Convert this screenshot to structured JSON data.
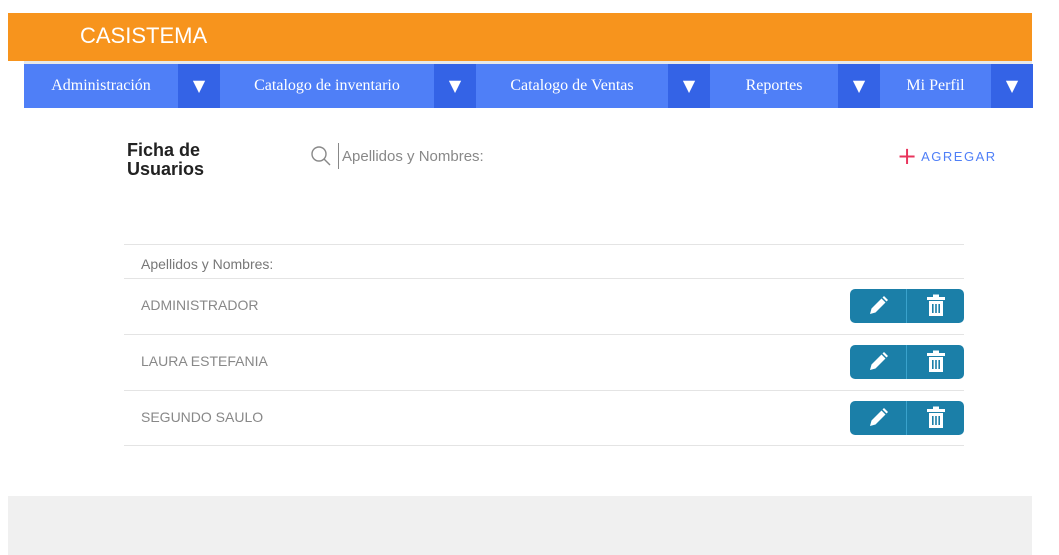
{
  "app": {
    "brand": "CASISTEMA"
  },
  "nav": {
    "menus": [
      {
        "label": "Administración",
        "caret": "▼"
      },
      {
        "label": "Catalogo de inventario",
        "caret": "▼"
      },
      {
        "label": "Catalogo de Ventas",
        "caret": "▼"
      },
      {
        "label": "Reportes",
        "caret": "▼"
      },
      {
        "label": "Mi Perfil",
        "caret": "▼"
      }
    ]
  },
  "page": {
    "title_line1": "Ficha de",
    "title_line2": "Usuarios",
    "search_placeholder": "Apellidos y Nombres:",
    "add_icon": "+",
    "add_label": "AGREGAR"
  },
  "table": {
    "header": "Apellidos y Nombres:",
    "rows": [
      {
        "name": "ADMINISTRADOR"
      },
      {
        "name": "LAURA ESTEFANIA"
      },
      {
        "name": "SEGUNDO SAULO"
      }
    ]
  },
  "icons": {
    "search": "search-icon",
    "edit": "pencil-icon",
    "delete": "trash-icon"
  },
  "colors": {
    "header": "#f7941d",
    "nav": "#4f7ff7",
    "nav_caret": "#3463e6",
    "action": "#1b7fa8",
    "add_plus": "#e8345c"
  }
}
